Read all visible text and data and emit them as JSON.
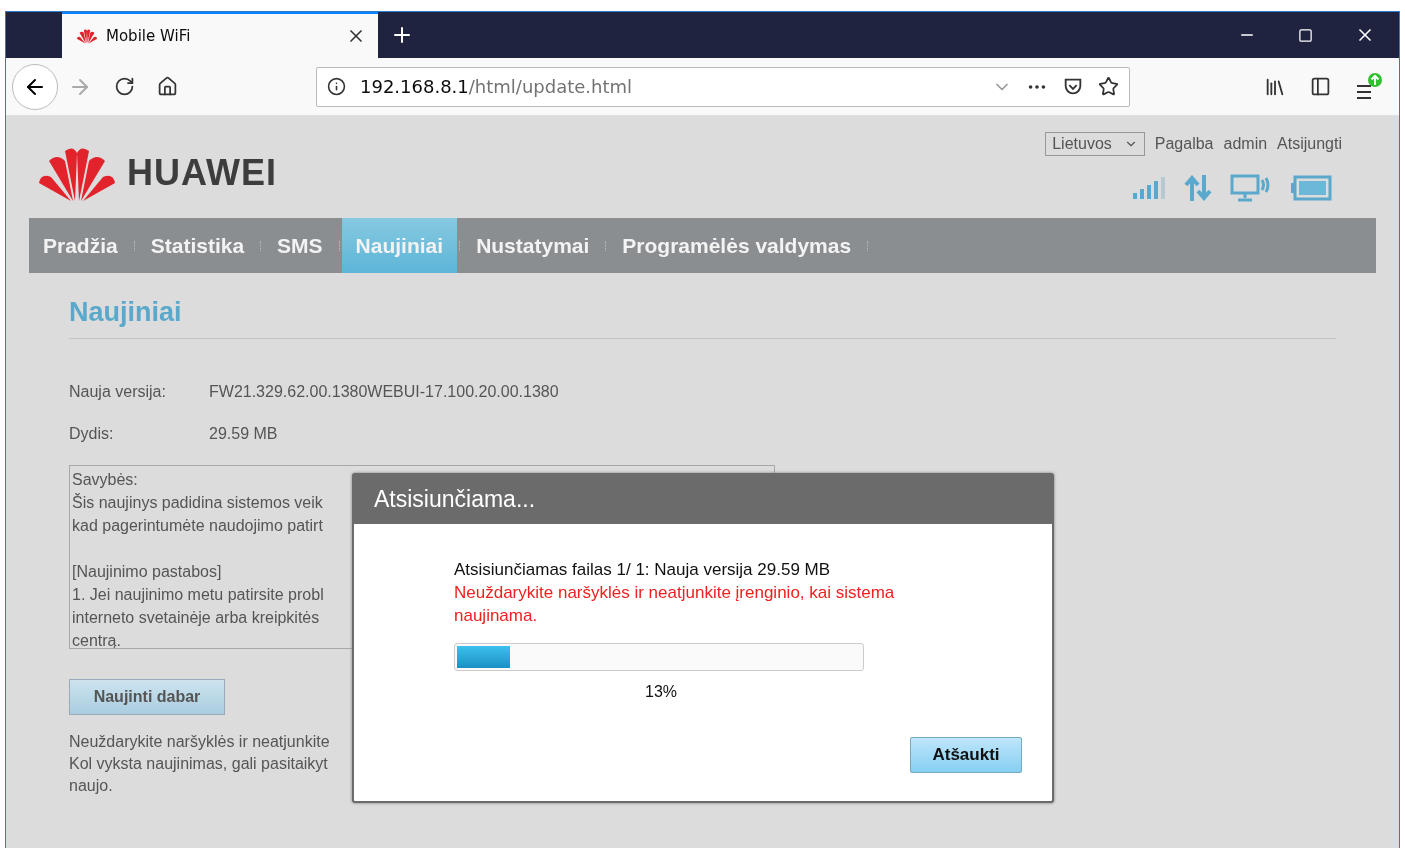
{
  "browser": {
    "tab": {
      "title": "Mobile WiFi",
      "selected": true
    },
    "url": {
      "host": "192.168.8.1",
      "path": "/html/update.html"
    }
  },
  "header": {
    "logo_text": "HUAWEI",
    "language": "Lietuvos",
    "links": [
      "Pagalba",
      "admin",
      "Atsijungti"
    ]
  },
  "nav": [
    {
      "label": "Pradžia",
      "selected": false
    },
    {
      "label": "Statistika",
      "selected": false
    },
    {
      "label": "SMS",
      "selected": false
    },
    {
      "label": "Naujiniai",
      "selected": true
    },
    {
      "label": "Nustatymai",
      "selected": false
    },
    {
      "label": "Programėlės valdymas",
      "selected": false
    }
  ],
  "page": {
    "title": "Naujiniai",
    "fields": [
      {
        "label": "Nauja versija:",
        "value": "FW21.329.62.00.1380WEBUI-17.100.20.00.1380"
      },
      {
        "label": "Dydis:",
        "value": "29.59 MB"
      }
    ],
    "notes": [
      [
        "Savybės:",
        "Šis naujinys padidina sistemos veik",
        "kad pagerintumėte naudojimo patirt"
      ],
      [
        "[Naujinimo pastabos]",
        "1. Jei naujinimo metu patirsite probl",
        "interneto svetainėje arba kreipkitės",
        "centrą."
      ]
    ],
    "update_button": "Naujinti dabar",
    "warning_lines": [
      "Neuždarykite naršyklės ir neatjunkite",
      "Kol vyksta naujinimas, gali pasitaikyt",
      "naujo."
    ]
  },
  "dialog": {
    "title": "Atsisiunčiama...",
    "file_line": "Atsisiunčiamas failas 1/ 1: Nauja versija 29.59 MB",
    "warning": "Neuždarykite naršyklės ir neatjunkite įrenginio, kai sistema naujinama.",
    "progress": {
      "level": 0.13
    },
    "percent": "13%",
    "cancel_button": "Atšaukti"
  }
}
